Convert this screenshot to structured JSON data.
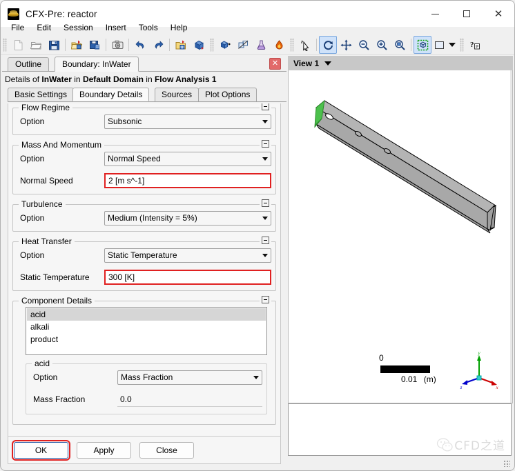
{
  "window": {
    "title": "CFX-Pre:  reactor",
    "icon": "cfx-app-icon",
    "minimize": "—",
    "maximize": "□",
    "close": "✕"
  },
  "menubar": {
    "items": [
      {
        "label": "File"
      },
      {
        "label": "Edit"
      },
      {
        "label": "Session"
      },
      {
        "label": "Insert"
      },
      {
        "label": "Tools"
      },
      {
        "label": "Help"
      }
    ]
  },
  "toolbar_main": {
    "buttons": [
      {
        "name": "new-case-icon",
        "title": "New Case"
      },
      {
        "name": "open-case-icon",
        "title": "Open Case"
      },
      {
        "name": "save-case-icon",
        "title": "Save Case"
      },
      {
        "name": "import-mesh-icon",
        "title": "Import Mesh"
      },
      {
        "name": "export-mesh-icon",
        "title": "Export Mesh"
      },
      {
        "name": "snapshot-icon",
        "title": "Snapshot"
      },
      {
        "name": "undo-icon",
        "title": "Undo"
      },
      {
        "name": "redo-icon",
        "title": "Redo"
      },
      {
        "name": "open-solver-files-icon",
        "title": "Open Solver Files"
      },
      {
        "name": "define-run-icon",
        "title": "Define Run"
      }
    ]
  },
  "toolbar_physics": {
    "buttons": [
      {
        "name": "domain-icon",
        "title": "Domain"
      },
      {
        "name": "boundary-icon",
        "title": "Boundary"
      },
      {
        "name": "material-icon",
        "title": "Material"
      },
      {
        "name": "reaction-icon",
        "title": "Reaction"
      },
      {
        "name": "expression-icon",
        "title": "Expression"
      },
      {
        "name": "cel-function-icon",
        "title": "CEL Function"
      },
      {
        "name": "subdomain-icon",
        "title": "Subdomain"
      },
      {
        "name": "user-function-icon",
        "title": "User Function"
      },
      {
        "name": "mesh-adaption-icon",
        "title": "Mesh Adaption"
      },
      {
        "name": "line-icon",
        "title": "Line"
      },
      {
        "name": "vector-icon",
        "title": "Vector"
      },
      {
        "name": "point-icon",
        "title": "Point"
      },
      {
        "name": "point-cloud-icon",
        "title": "Point Cloud"
      }
    ]
  },
  "toolbar_timing": {
    "buttons": [
      {
        "name": "clock-icon",
        "title": "Analysis Type"
      },
      {
        "name": "initialization-icon",
        "title": "Global Initialization"
      },
      {
        "name": "solver-control-icon",
        "title": "Solver Control"
      }
    ],
    "overflow": "»"
  },
  "toolbar_extra": {
    "buttons": [
      {
        "name": "cfx-logo-icon",
        "title": "CFX"
      }
    ],
    "overflow": "»"
  },
  "toolbar_view": {
    "buttons": [
      {
        "name": "select-pick-icon",
        "title": "Single Select"
      },
      {
        "name": "rotate-icon",
        "title": "Rotate",
        "active": true
      },
      {
        "name": "pan-icon",
        "title": "Pan"
      },
      {
        "name": "zoom-box-icon",
        "title": "Zoom Box"
      },
      {
        "name": "zoom-in-icon",
        "title": "Zoom In"
      },
      {
        "name": "zoom-fit-icon",
        "title": "Fit View"
      },
      {
        "name": "isometric-view-icon",
        "title": "Isometric View",
        "active": true
      },
      {
        "name": "background-color-icon",
        "title": "Background"
      },
      {
        "name": "help-context-icon",
        "title": "Context Help"
      }
    ]
  },
  "panel": {
    "tabs": [
      {
        "label": "Outline",
        "selected": false
      },
      {
        "label": "Boundary: InWater",
        "selected": true
      }
    ],
    "close_glyph": "✕",
    "details": {
      "prefix": "Details of ",
      "object": "InWater",
      "mid1": " in ",
      "domain": "Default Domain",
      "mid2": " in ",
      "analysis": "Flow Analysis 1"
    },
    "subtabs": [
      {
        "label": "Basic Settings",
        "selected": false
      },
      {
        "label": "Boundary Details",
        "selected": true
      },
      {
        "label": "Sources",
        "selected": false
      },
      {
        "label": "Plot Options",
        "selected": false
      }
    ]
  },
  "form": {
    "flow_regime": {
      "title": "Flow Regime",
      "option_label": "Option",
      "option_value": "Subsonic"
    },
    "mass_momentum": {
      "title": "Mass And Momentum",
      "option_label": "Option",
      "option_value": "Normal Speed",
      "speed_label": "Normal Speed",
      "speed_value": "2 [m s^-1]"
    },
    "turbulence": {
      "title": "Turbulence",
      "option_label": "Option",
      "option_value": "Medium (Intensity = 5%)"
    },
    "heat_transfer": {
      "title": "Heat Transfer",
      "option_label": "Option",
      "option_value": "Static Temperature",
      "temp_label": "Static Temperature",
      "temp_value": "300 [K]"
    },
    "component_details": {
      "title": "Component Details",
      "components": [
        {
          "name": "acid",
          "selected": true
        },
        {
          "name": "alkali",
          "selected": false
        },
        {
          "name": "product",
          "selected": false
        }
      ],
      "selected_title": "acid",
      "option_label": "Option",
      "option_value": "Mass Fraction",
      "fraction_label": "Mass Fraction",
      "fraction_value": "0.0"
    }
  },
  "buttons": {
    "ok": "OK",
    "apply": "Apply",
    "close": "Close"
  },
  "viewport": {
    "view_label": "View 1",
    "scale": {
      "min": "0",
      "max": "0.01",
      "unit": "(m)"
    },
    "axes": {
      "x": "x",
      "y": "y",
      "z": "z",
      "x_color": "#cc0000",
      "y_color": "#00a000",
      "z_color": "#0000cc"
    },
    "geometry": {
      "body_color": "#a6a6a6",
      "top_color": "#b5b5b5",
      "side_color": "#9c9c9c",
      "inlet_color": "#4cc04c",
      "edge_color": "#000000"
    }
  },
  "watermark": {
    "text": "CFD之道",
    "icon": "wechat-icon"
  }
}
